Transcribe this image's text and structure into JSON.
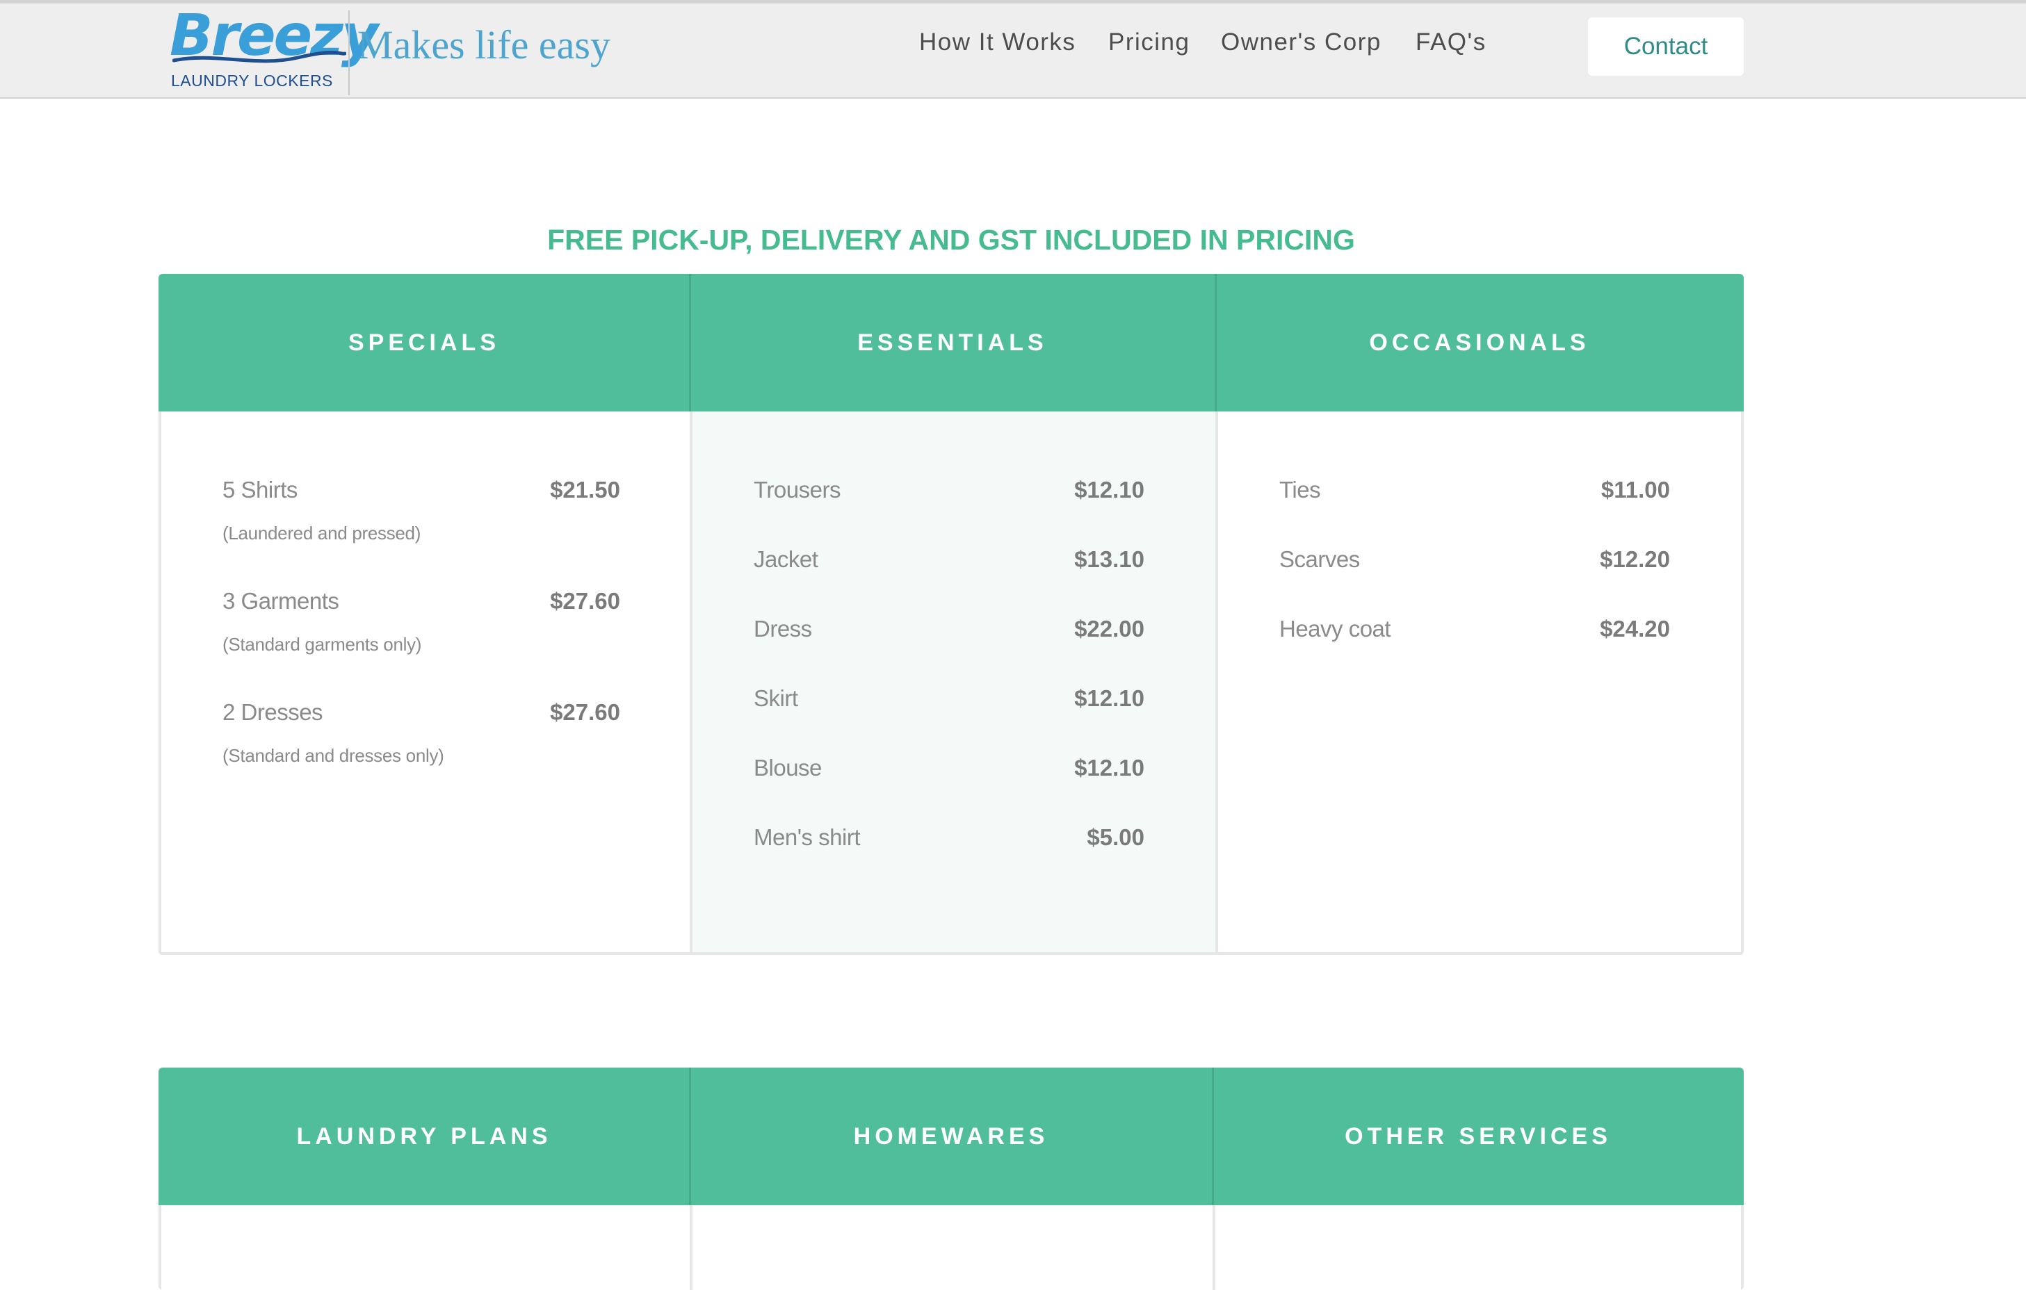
{
  "header": {
    "logo_text": "Breezy",
    "logo_subtitle": "LAUNDRY LOCKERS",
    "tagline": "Makes life easy",
    "nav": [
      {
        "label": "How It Works"
      },
      {
        "label": "Pricing"
      },
      {
        "label": "Owner's Corp"
      },
      {
        "label": "FAQ's"
      }
    ],
    "contact_label": "Contact"
  },
  "headline": "FREE PICK-UP, DELIVERY AND GST INCLUDED IN PRICING",
  "panel_top": {
    "columns": [
      {
        "title": "SPECIALS",
        "items": [
          {
            "name": "5 Shirts",
            "price": "$21.50",
            "note": "(Laundered and pressed)"
          },
          {
            "name": "3 Garments",
            "price": "$27.60",
            "note": "(Standard garments only)"
          },
          {
            "name": "2 Dresses",
            "price": "$27.60",
            "note": "(Standard and dresses only)"
          }
        ]
      },
      {
        "title": "ESSENTIALS",
        "items": [
          {
            "name": "Trousers",
            "price": "$12.10"
          },
          {
            "name": "Jacket",
            "price": "$13.10"
          },
          {
            "name": "Dress",
            "price": "$22.00"
          },
          {
            "name": "Skirt",
            "price": "$12.10"
          },
          {
            "name": "Blouse",
            "price": "$12.10"
          },
          {
            "name": "Men's shirt",
            "price": "$5.00"
          }
        ]
      },
      {
        "title": "OCCASIONALS",
        "items": [
          {
            "name": "Ties",
            "price": "$11.00"
          },
          {
            "name": "Scarves",
            "price": "$12.20"
          },
          {
            "name": "Heavy coat",
            "price": "$24.20"
          }
        ]
      }
    ]
  },
  "panel_bottom": {
    "columns": [
      {
        "title": "LAUNDRY PLANS"
      },
      {
        "title": "HOMEWARES"
      },
      {
        "title": "OTHER SERVICES"
      }
    ]
  },
  "colors": {
    "accent_green": "#50bd9b",
    "headline_green": "#47bb90",
    "logo_blue": "#3a9fd8",
    "tagline_blue": "#4da5cf",
    "essentials_tint": "#f3faf8"
  }
}
